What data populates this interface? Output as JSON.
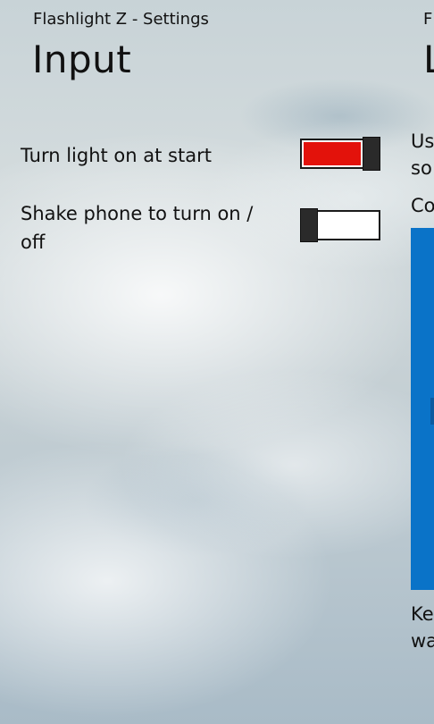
{
  "app": {
    "title": "Flashlight Z - Settings",
    "title_next_fragment": "Fl"
  },
  "page": {
    "header": "Input",
    "header_next_fragment": "L"
  },
  "settings": [
    {
      "label": "Turn light on at start",
      "toggle_on": true
    },
    {
      "label": "Shake phone to turn on / off",
      "toggle_on": false
    }
  ],
  "next_panel": {
    "lines": [
      "Us",
      "so",
      "Co",
      "Ke",
      "wa"
    ]
  },
  "colors": {
    "toggle_on_fill": "#e3120b",
    "toggle_thumb": "#2a2a2a",
    "accent_blue": "#0a73c8",
    "text": "#111111"
  }
}
